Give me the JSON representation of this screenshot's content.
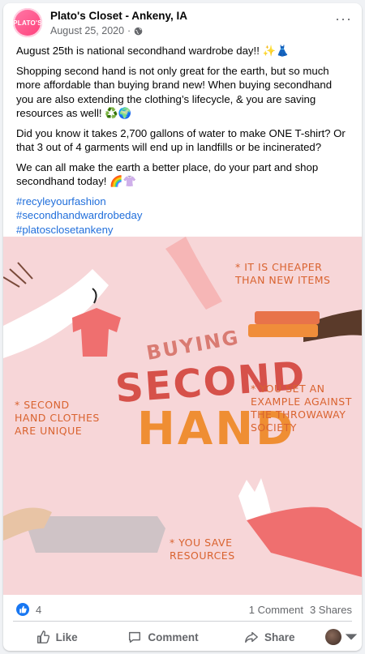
{
  "post": {
    "page_name": "Plato's Closet - Ankeny, IA",
    "avatar_text": "PLATO'S",
    "date": "August 25, 2020",
    "date_separator": "·",
    "more": "···",
    "paragraphs": [
      "August 25th is national secondhand wardrobe day!! ✨👗",
      "Shopping second hand is not only great for the earth, but so much more affordable than buying brand new! When buying secondhand you are also extending the clothing’s lifecycle, & you are saving resources as well! ♻️🌍",
      "Did you know it takes 2,700 gallons of water to make ONE T-shirt? Or that 3 out of 4 garments will end up in landfills or be incinerated?",
      "We can all make the earth a better place, do your part and shop secondhand today! 🌈👚"
    ],
    "hashtags": [
      "#recyleyourfashion",
      "#secondhandwardrobeday",
      "#platosclosetankeny"
    ]
  },
  "image": {
    "headline_buying": "Buying",
    "headline_second": "Second",
    "headline_hand": "Hand",
    "note_cheaper": "* It is cheaper than new items",
    "note_unique": "* Second hand clothes are unique",
    "note_example": "* You set an example against the throwaway society",
    "note_resources": "* You save resources",
    "colors": {
      "background": "#f7d6d8",
      "accent_red": "#d6514a",
      "accent_orange": "#ef8e33"
    }
  },
  "stats": {
    "like_count": "4",
    "comments": "1 Comment",
    "shares": "3 Shares"
  },
  "actions": {
    "like": "Like",
    "comment": "Comment",
    "share": "Share"
  }
}
